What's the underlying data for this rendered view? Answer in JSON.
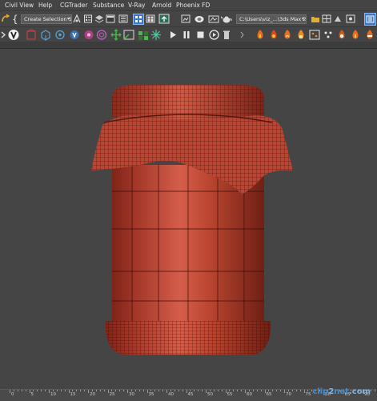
{
  "menu": {
    "items": [
      "Civil View",
      "Help",
      "CGTrader",
      "Substance",
      "V-Ray",
      "Arnold",
      "Phoenix FD"
    ]
  },
  "toolbar": {
    "selection_set_label": "Create Selection Se",
    "project_path": "C:\\Users\\viz_...\\3ds Max 202"
  },
  "icons": {
    "toolbar1": [
      "undo-redo-icon",
      "brace-icon",
      "selection-set-dropdown",
      "named-selection-icon",
      "toggle-scene-explorer-icon",
      "toggle-layer-explorer-icon",
      "toggle-ribbon-icon",
      "curve-editor-icon",
      "schematic-view-icon",
      "material-editor-icon",
      "render-setup-icon",
      "rendered-frame-window-icon",
      "render-icon",
      "teapot-render-icon",
      "project-path-dropdown",
      "folder-icon",
      "active-tool-icon"
    ],
    "toolbar2": [
      "chevron-icon",
      "vray-logo-icon",
      "vray-material-icon",
      "vray-light-icon",
      "vray-camera-icon",
      "vray-proxy-icon",
      "vray-fur-icon",
      "move-gizmo-icon",
      "vray-frame-buffer-icon",
      "vray-sun-icon",
      "play-icon",
      "pause-icon",
      "stop-icon",
      "render-interactive-icon",
      "trash-icon",
      "phoenix-fire-icon",
      "phoenix-liquid-icon",
      "phoenix-ocean-icon",
      "phoenix-source-icon",
      "phoenix-particle-icon",
      "phoenix-dots-icon",
      "phoenix-foam-icon",
      "phoenix-smoke-icon"
    ]
  },
  "timeline": {
    "tick_labels": [
      "0",
      "5",
      "10",
      "15",
      "20",
      "25",
      "30",
      "35",
      "40",
      "45",
      "50",
      "55",
      "60",
      "65",
      "70",
      "75",
      "80",
      "85",
      "90"
    ]
  },
  "viewport": {
    "background": "#454545",
    "mesh_color": "#a83a2c",
    "mesh_highlight": "#d15a44",
    "wire_color": "#3a0e08"
  },
  "watermark": {
    "brand_a": "clip",
    "brand_b": "2",
    "brand_c": "net",
    "brand_d": ".com"
  }
}
